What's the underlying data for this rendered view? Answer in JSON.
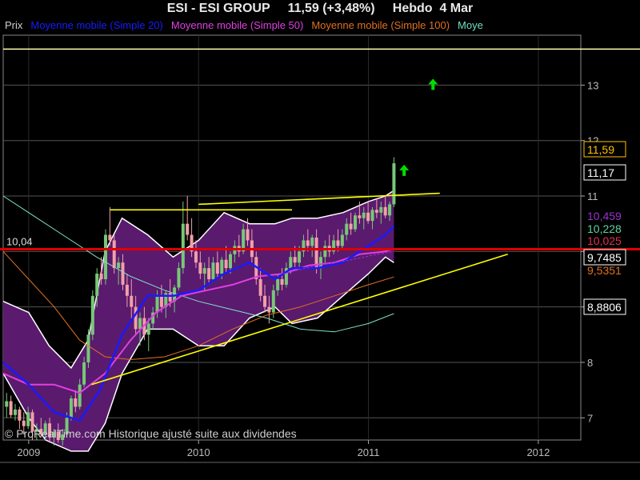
{
  "header": {
    "title": "ESI - ESI GROUP     11,59 (+3,48%)     Hebdo  4 Mar"
  },
  "legend": {
    "items": [
      {
        "label": "Prix",
        "color": "#d0d0d0"
      },
      {
        "label": "Moyenne mobile (Simple 20)",
        "color": "#1a1aff"
      },
      {
        "label": "Moyenne mobile (Simple 50)",
        "color": "#e040e0"
      },
      {
        "label": "Moyenne mobile (Simple 100)",
        "color": "#e07020"
      },
      {
        "label": "Moye",
        "color": "#70e0c0"
      }
    ]
  },
  "watermark": "© ProRealTime.com Historique ajusté suite aux dividendes",
  "chart_data": {
    "type": "candlestick",
    "x_ticks": [
      "2009",
      "2010",
      "2011",
      "2012"
    ],
    "y_ticks": [
      7,
      8,
      9,
      10,
      11,
      12,
      13
    ],
    "ylim": [
      6.6,
      13.9
    ],
    "xlim": [
      2008.85,
      2012.25
    ],
    "price_labels": [
      {
        "text": "11,59",
        "color": "#ffc000",
        "boxed": true,
        "value": 11.59
      },
      {
        "text": "11,17",
        "color": "#ffffff",
        "boxed": true,
        "value": 11.17
      },
      {
        "text": "10,459",
        "color": "#9933cc",
        "boxed": false,
        "value": 10.459
      },
      {
        "text": "10,228",
        "color": "#60d0a0",
        "boxed": false,
        "value": 10.228
      },
      {
        "text": "10,025",
        "color": "#e03050",
        "boxed": false,
        "value": 10.025
      },
      {
        "text": "9,7485",
        "color": "#ffffff",
        "boxed": true,
        "value": 9.7485
      },
      {
        "text": "9,5351",
        "color": "#e07020",
        "boxed": false,
        "value": 9.5351
      },
      {
        "text": "8,8806",
        "color": "#ffffff",
        "boxed": true,
        "value": 8.8806
      }
    ],
    "hline": {
      "value": 10.04,
      "label": "10,04",
      "color": "#e00000"
    },
    "top_line": {
      "value": 13.65,
      "color": "#ffffaa"
    },
    "trendlines": [
      {
        "x": [
          2009.48,
          2010.55
        ],
        "y": [
          10.75,
          10.75
        ],
        "color": "#ffff00"
      },
      {
        "x": [
          2010.0,
          2011.42
        ],
        "y": [
          10.85,
          11.05
        ],
        "color": "#ffff00"
      },
      {
        "x": [
          2009.37,
          2011.82
        ],
        "y": [
          7.6,
          9.95
        ],
        "color": "#ffff00"
      }
    ],
    "arrows": [
      {
        "x": 2011.38,
        "y": 13.0,
        "color": "#00dd00"
      },
      {
        "x": 2011.21,
        "y": 11.45,
        "color": "#00dd00"
      }
    ],
    "candles": {
      "note": "weekly OHLC approximated",
      "ohlc": [
        [
          7.2,
          7.45,
          7.0,
          7.3
        ],
        [
          7.3,
          7.4,
          7.0,
          7.05
        ],
        [
          7.05,
          7.25,
          6.95,
          7.15
        ],
        [
          7.15,
          7.2,
          6.8,
          6.95
        ],
        [
          6.95,
          7.1,
          6.7,
          6.85
        ],
        [
          6.85,
          7.2,
          6.8,
          7.1
        ],
        [
          7.1,
          7.15,
          6.6,
          6.75
        ],
        [
          6.75,
          6.9,
          6.6,
          6.8
        ],
        [
          6.8,
          7.0,
          6.65,
          6.7
        ],
        [
          6.7,
          6.95,
          6.6,
          6.9
        ],
        [
          6.9,
          7.0,
          6.55,
          6.65
        ],
        [
          6.65,
          6.8,
          6.5,
          6.75
        ],
        [
          6.75,
          6.9,
          6.55,
          6.6
        ],
        [
          6.6,
          6.8,
          6.5,
          6.7
        ],
        [
          6.7,
          7.1,
          6.65,
          7.0
        ],
        [
          7.0,
          7.4,
          6.95,
          7.35
        ],
        [
          7.35,
          7.5,
          7.1,
          7.2
        ],
        [
          7.2,
          7.7,
          7.15,
          7.6
        ],
        [
          7.6,
          8.1,
          7.55,
          8.0
        ],
        [
          8.0,
          8.6,
          7.9,
          8.5
        ],
        [
          8.5,
          9.3,
          8.4,
          9.2
        ],
        [
          9.2,
          9.7,
          9.0,
          9.6
        ],
        [
          9.6,
          9.9,
          9.4,
          9.5
        ],
        [
          9.5,
          10.4,
          9.4,
          10.3
        ],
        [
          10.3,
          10.8,
          10.1,
          10.2
        ],
        [
          10.2,
          10.3,
          9.6,
          9.7
        ],
        [
          9.7,
          9.9,
          9.4,
          9.8
        ],
        [
          9.8,
          9.95,
          9.3,
          9.4
        ],
        [
          9.4,
          9.6,
          9.0,
          9.2
        ],
        [
          9.2,
          9.5,
          8.8,
          9.0
        ],
        [
          9.0,
          9.2,
          8.5,
          8.6
        ],
        [
          8.6,
          8.9,
          8.3,
          8.8
        ],
        [
          8.8,
          9.0,
          8.4,
          8.5
        ],
        [
          8.5,
          8.8,
          8.2,
          8.7
        ],
        [
          8.7,
          9.0,
          8.6,
          8.9
        ],
        [
          8.9,
          9.3,
          8.8,
          9.2
        ],
        [
          9.2,
          9.4,
          8.9,
          9.0
        ],
        [
          9.0,
          9.3,
          8.8,
          9.25
        ],
        [
          9.25,
          9.5,
          9.0,
          9.1
        ],
        [
          9.1,
          9.4,
          8.9,
          9.35
        ],
        [
          9.35,
          9.8,
          9.3,
          9.7
        ],
        [
          9.7,
          10.9,
          9.6,
          10.5
        ],
        [
          10.5,
          11.0,
          10.2,
          10.3
        ],
        [
          10.3,
          10.6,
          9.9,
          10.0
        ],
        [
          10.0,
          10.2,
          9.7,
          9.8
        ],
        [
          9.8,
          10.0,
          9.5,
          9.6
        ],
        [
          9.6,
          9.8,
          9.3,
          9.7
        ],
        [
          9.7,
          9.9,
          9.4,
          9.5
        ],
        [
          9.5,
          9.9,
          9.45,
          9.8
        ],
        [
          9.8,
          10.0,
          9.5,
          9.6
        ],
        [
          9.6,
          9.9,
          9.5,
          9.85
        ],
        [
          9.85,
          10.1,
          9.6,
          9.7
        ],
        [
          9.7,
          10.0,
          9.6,
          9.95
        ],
        [
          9.95,
          10.2,
          9.8,
          10.1
        ],
        [
          10.1,
          10.3,
          9.9,
          10.0
        ],
        [
          10.0,
          10.5,
          9.95,
          10.4
        ],
        [
          10.4,
          10.6,
          10.1,
          10.2
        ],
        [
          10.2,
          10.4,
          9.8,
          9.9
        ],
        [
          9.9,
          10.0,
          9.4,
          9.5
        ],
        [
          9.5,
          9.7,
          9.1,
          9.2
        ],
        [
          9.2,
          9.4,
          8.9,
          9.0
        ],
        [
          9.0,
          9.2,
          8.7,
          8.9
        ],
        [
          8.9,
          9.4,
          8.8,
          9.3
        ],
        [
          9.3,
          9.6,
          9.2,
          9.5
        ],
        [
          9.5,
          9.7,
          9.3,
          9.4
        ],
        [
          9.4,
          9.8,
          9.35,
          9.7
        ],
        [
          9.7,
          10.0,
          9.6,
          9.9
        ],
        [
          9.9,
          10.1,
          9.7,
          9.8
        ],
        [
          9.8,
          10.1,
          9.7,
          10.0
        ],
        [
          10.0,
          10.3,
          9.9,
          10.2
        ],
        [
          10.2,
          10.4,
          10.0,
          10.1
        ],
        [
          10.1,
          10.3,
          9.9,
          10.25
        ],
        [
          10.25,
          10.4,
          9.6,
          9.7
        ],
        [
          9.7,
          10.0,
          9.5,
          9.9
        ],
        [
          9.9,
          10.2,
          9.8,
          10.1
        ],
        [
          10.1,
          10.3,
          9.9,
          10.0
        ],
        [
          10.0,
          10.3,
          9.95,
          10.2
        ],
        [
          10.2,
          10.4,
          10.0,
          10.1
        ],
        [
          10.1,
          10.4,
          10.05,
          10.3
        ],
        [
          10.3,
          10.6,
          10.2,
          10.5
        ],
        [
          10.5,
          10.7,
          10.3,
          10.4
        ],
        [
          10.4,
          10.7,
          10.35,
          10.65
        ],
        [
          10.65,
          10.9,
          10.5,
          10.6
        ],
        [
          10.6,
          10.8,
          10.4,
          10.7
        ],
        [
          10.7,
          10.9,
          10.5,
          10.55
        ],
        [
          10.55,
          10.8,
          10.4,
          10.75
        ],
        [
          10.75,
          10.95,
          10.6,
          10.7
        ],
        [
          10.7,
          10.9,
          10.5,
          10.8
        ],
        [
          10.8,
          11.0,
          10.6,
          10.65
        ],
        [
          10.65,
          10.9,
          10.55,
          10.85
        ],
        [
          10.85,
          11.7,
          10.8,
          11.59
        ]
      ]
    },
    "bollinger_upper": [
      [
        2008.85,
        9.1
      ],
      [
        2009.0,
        8.9
      ],
      [
        2009.12,
        8.3
      ],
      [
        2009.25,
        7.9
      ],
      [
        2009.35,
        8.4
      ],
      [
        2009.45,
        10.0
      ],
      [
        2009.55,
        10.6
      ],
      [
        2009.7,
        10.3
      ],
      [
        2009.85,
        9.9
      ],
      [
        2010.0,
        10.2
      ],
      [
        2010.15,
        10.7
      ],
      [
        2010.3,
        10.5
      ],
      [
        2010.45,
        10.5
      ],
      [
        2010.55,
        10.6
      ],
      [
        2010.7,
        10.6
      ],
      [
        2010.85,
        10.7
      ],
      [
        2011.0,
        10.9
      ],
      [
        2011.1,
        11.0
      ],
      [
        2011.15,
        11.1
      ]
    ],
    "bollinger_lower": [
      [
        2008.85,
        7.8
      ],
      [
        2009.0,
        7.0
      ],
      [
        2009.1,
        6.6
      ],
      [
        2009.25,
        6.4
      ],
      [
        2009.35,
        6.4
      ],
      [
        2009.45,
        6.9
      ],
      [
        2009.55,
        7.8
      ],
      [
        2009.7,
        8.6
      ],
      [
        2009.85,
        8.6
      ],
      [
        2010.0,
        8.3
      ],
      [
        2010.15,
        8.3
      ],
      [
        2010.3,
        8.8
      ],
      [
        2010.45,
        9.0
      ],
      [
        2010.55,
        8.7
      ],
      [
        2010.7,
        8.8
      ],
      [
        2010.85,
        9.2
      ],
      [
        2011.0,
        9.6
      ],
      [
        2011.1,
        9.9
      ],
      [
        2011.15,
        9.8
      ]
    ],
    "ma20": [
      [
        2008.85,
        8.0
      ],
      [
        2009.0,
        7.6
      ],
      [
        2009.15,
        7.1
      ],
      [
        2009.3,
        6.95
      ],
      [
        2009.42,
        7.5
      ],
      [
        2009.55,
        8.5
      ],
      [
        2009.7,
        9.2
      ],
      [
        2009.85,
        9.2
      ],
      [
        2010.0,
        9.3
      ],
      [
        2010.15,
        9.6
      ],
      [
        2010.3,
        9.8
      ],
      [
        2010.45,
        9.5
      ],
      [
        2010.55,
        9.7
      ],
      [
        2010.7,
        9.7
      ],
      [
        2010.85,
        9.8
      ],
      [
        2011.0,
        10.1
      ],
      [
        2011.1,
        10.3
      ],
      [
        2011.15,
        10.46
      ]
    ],
    "ma50": [
      [
        2008.85,
        7.8
      ],
      [
        2009.0,
        7.6
      ],
      [
        2009.15,
        7.6
      ],
      [
        2009.3,
        7.45
      ],
      [
        2009.45,
        7.8
      ],
      [
        2009.6,
        8.4
      ],
      [
        2009.75,
        8.9
      ],
      [
        2009.9,
        9.2
      ],
      [
        2010.05,
        9.3
      ],
      [
        2010.2,
        9.4
      ],
      [
        2010.35,
        9.55
      ],
      [
        2010.5,
        9.6
      ],
      [
        2010.65,
        9.75
      ],
      [
        2010.8,
        9.8
      ],
      [
        2010.95,
        9.95
      ],
      [
        2011.1,
        10.0
      ],
      [
        2011.15,
        10.05
      ]
    ],
    "ma100": [
      [
        2008.85,
        10.0
      ],
      [
        2009.0,
        9.5
      ],
      [
        2009.15,
        9.0
      ],
      [
        2009.3,
        8.4
      ],
      [
        2009.45,
        8.1
      ],
      [
        2009.6,
        8.05
      ],
      [
        2009.8,
        8.1
      ],
      [
        2010.0,
        8.3
      ],
      [
        2010.2,
        8.6
      ],
      [
        2010.4,
        8.85
      ],
      [
        2010.6,
        9.0
      ],
      [
        2010.8,
        9.2
      ],
      [
        2011.0,
        9.4
      ],
      [
        2011.15,
        9.54
      ]
    ],
    "ma_extra": [
      [
        2008.85,
        11.0
      ],
      [
        2009.0,
        10.7
      ],
      [
        2009.2,
        10.3
      ],
      [
        2009.4,
        9.9
      ],
      [
        2009.6,
        9.55
      ],
      [
        2009.8,
        9.3
      ],
      [
        2010.0,
        9.1
      ],
      [
        2010.2,
        8.95
      ],
      [
        2010.4,
        8.8
      ],
      [
        2010.6,
        8.6
      ],
      [
        2010.8,
        8.55
      ],
      [
        2011.0,
        8.7
      ],
      [
        2011.15,
        8.88
      ]
    ],
    "mini_series": [
      [
        2010.5,
        9.6
      ],
      [
        2010.7,
        9.75
      ],
      [
        2010.9,
        9.85
      ],
      [
        2011.05,
        9.95
      ],
      [
        2011.15,
        10.0
      ]
    ]
  }
}
